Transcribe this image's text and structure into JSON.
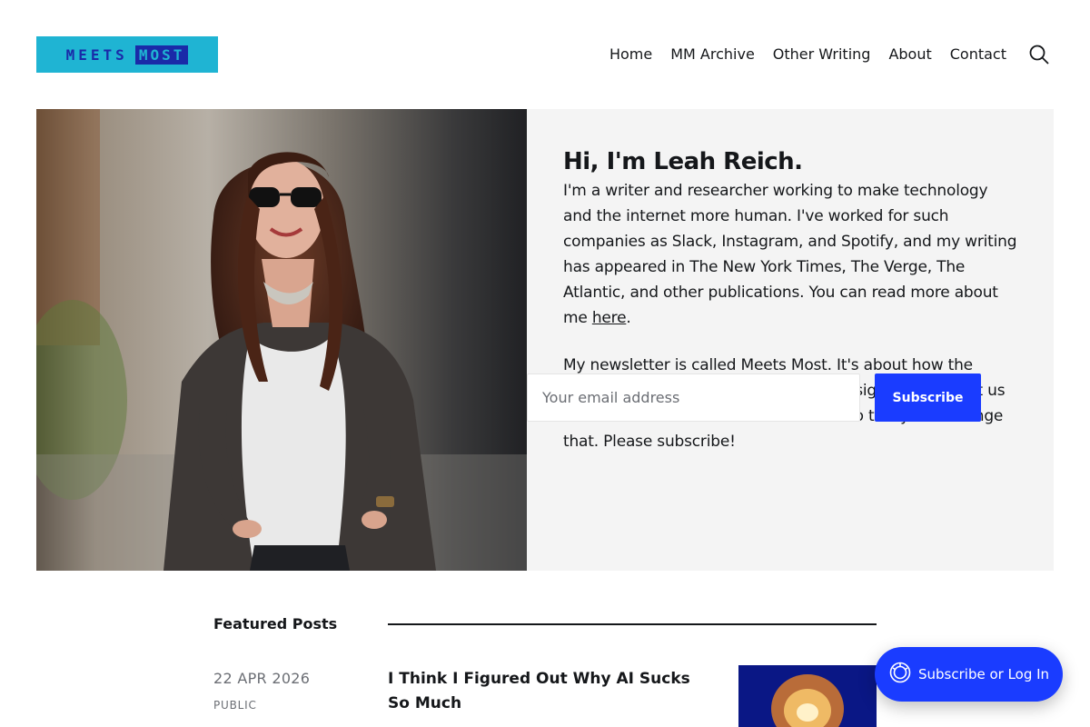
{
  "brand": {
    "logo_word1": "MEETS",
    "logo_word2": "MOST",
    "logo_bg": "#1fb4d3",
    "logo_fg": "#1a2aa8"
  },
  "nav": {
    "items": [
      {
        "label": "Home"
      },
      {
        "label": "MM Archive"
      },
      {
        "label": "Other Writing"
      },
      {
        "label": "About"
      },
      {
        "label": "Contact"
      }
    ],
    "search_icon": "search-icon"
  },
  "hero": {
    "title": "Hi, I'm Leah Reich.",
    "paragraph1_before_link": "I'm a writer and researcher working to make technology and the internet more human. I've worked for such companies as Slack, Instagram, and Spotify, and my writing has appeared in The New York Times, The Verge, The Atlantic, and other publications. You can read more about me ",
    "paragraph1_link": "here",
    "paragraph1_after_link": ".",
    "paragraph2": "My newsletter is called Meets Most. It's about how the technology we use every day is not designed to benefit us as humans – and about what we can do to try and change that. Please subscribe!",
    "email_placeholder": "Your email address",
    "subscribe_label": "Subscribe",
    "accent": "#1a3cff"
  },
  "featured": {
    "heading": "Featured Posts",
    "posts": [
      {
        "date": "22 APR 2026",
        "visibility": "PUBLIC",
        "title": "I Think I Figured Out Why AI Sucks So Much"
      }
    ]
  },
  "portal": {
    "label": "Subscribe or Log In",
    "icon": "portal-icon"
  }
}
